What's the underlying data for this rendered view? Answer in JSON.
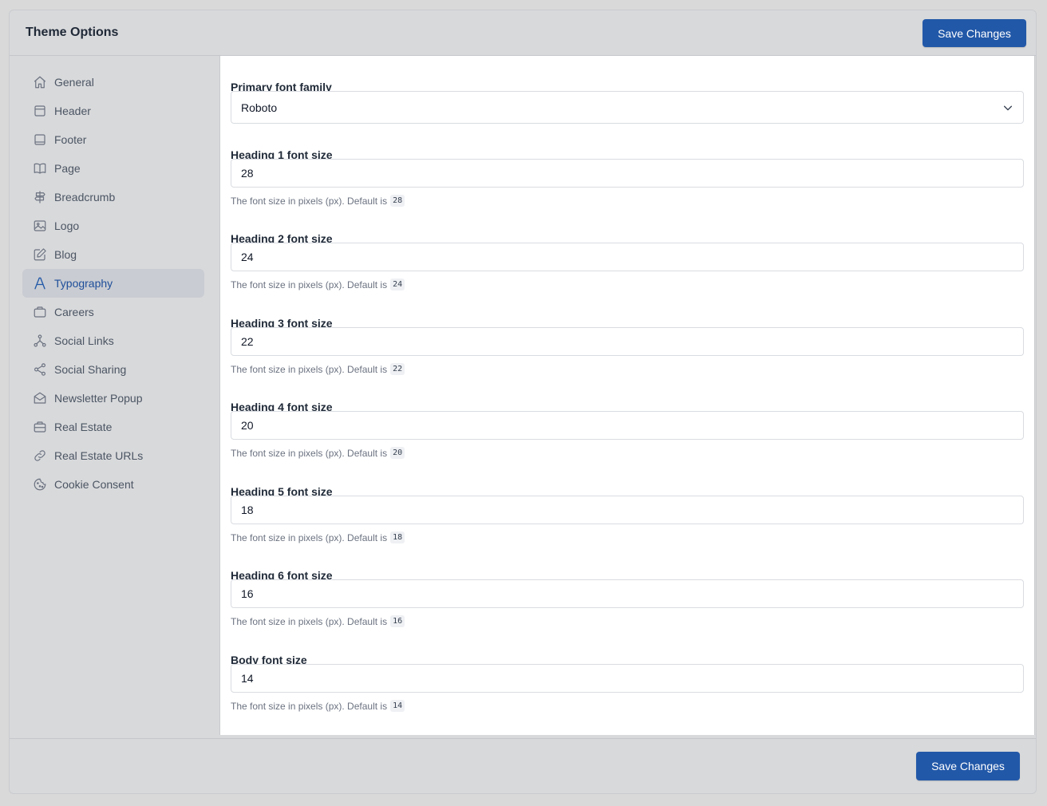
{
  "header": {
    "title": "Theme Options",
    "save_label": "Save Changes"
  },
  "sidebar": {
    "items": [
      {
        "label": "General",
        "icon": "home-icon"
      },
      {
        "label": "Header",
        "icon": "layout-header-icon"
      },
      {
        "label": "Footer",
        "icon": "layout-footer-icon"
      },
      {
        "label": "Page",
        "icon": "book-icon"
      },
      {
        "label": "Breadcrumb",
        "icon": "signpost-icon"
      },
      {
        "label": "Logo",
        "icon": "image-icon"
      },
      {
        "label": "Blog",
        "icon": "edit-icon"
      },
      {
        "label": "Typography",
        "icon": "typography-icon",
        "active": true
      },
      {
        "label": "Careers",
        "icon": "briefcase-icon"
      },
      {
        "label": "Social Links",
        "icon": "network-icon"
      },
      {
        "label": "Social Sharing",
        "icon": "share-icon"
      },
      {
        "label": "Newsletter Popup",
        "icon": "mail-open-icon"
      },
      {
        "label": "Real Estate",
        "icon": "toolbox-icon"
      },
      {
        "label": "Real Estate URLs",
        "icon": "link-icon"
      },
      {
        "label": "Cookie Consent",
        "icon": "cookie-icon"
      }
    ]
  },
  "form": {
    "font_family": {
      "label": "Primary font family",
      "value": "Roboto"
    },
    "sizes": [
      {
        "label": "Heading 1 font size",
        "value": "28",
        "help": "The font size in pixels (px). Default is",
        "default": "28"
      },
      {
        "label": "Heading 2 font size",
        "value": "24",
        "help": "The font size in pixels (px). Default is",
        "default": "24"
      },
      {
        "label": "Heading 3 font size",
        "value": "22",
        "help": "The font size in pixels (px). Default is",
        "default": "22"
      },
      {
        "label": "Heading 4 font size",
        "value": "20",
        "help": "The font size in pixels (px). Default is",
        "default": "20"
      },
      {
        "label": "Heading 5 font size",
        "value": "18",
        "help": "The font size in pixels (px). Default is",
        "default": "18"
      },
      {
        "label": "Heading 6 font size",
        "value": "16",
        "help": "The font size in pixels (px). Default is",
        "default": "16"
      },
      {
        "label": "Body font size",
        "value": "14",
        "help": "The font size in pixels (px). Default is",
        "default": "14"
      }
    ]
  },
  "footer": {
    "save_label": "Save Changes"
  },
  "colors": {
    "accent": "#2258a8",
    "active_nav_bg": "#c9ccd2",
    "active_nav_text": "#1e4e9a"
  }
}
